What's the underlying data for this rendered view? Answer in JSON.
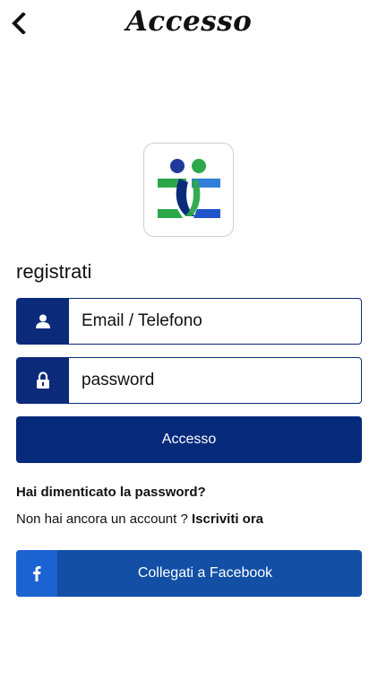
{
  "header": {
    "title": "Accesso",
    "back_icon": "chevron-left-icon"
  },
  "logo": {
    "icon": "app-logo-icon",
    "colors": {
      "green": "#2aa84a",
      "blue": "#1f55c8",
      "navy": "#0b2a7a"
    }
  },
  "form": {
    "section_label": "registrati",
    "email": {
      "icon": "user-icon",
      "placeholder": "Email / Telefono",
      "value": ""
    },
    "password": {
      "icon": "lock-icon",
      "placeholder": "password",
      "value": ""
    },
    "submit_label": "Accesso"
  },
  "links": {
    "forgot_password": "Hai dimenticato la password?",
    "no_account_text": "Non hai ancora un account ?",
    "signup_label": "Iscriviti ora"
  },
  "facebook": {
    "icon": "facebook-icon",
    "label": "Collegati a Facebook"
  },
  "colors": {
    "primary": "#062a7a",
    "facebook": "#124fa5",
    "facebook_icon_bg": "#1c63d2"
  }
}
